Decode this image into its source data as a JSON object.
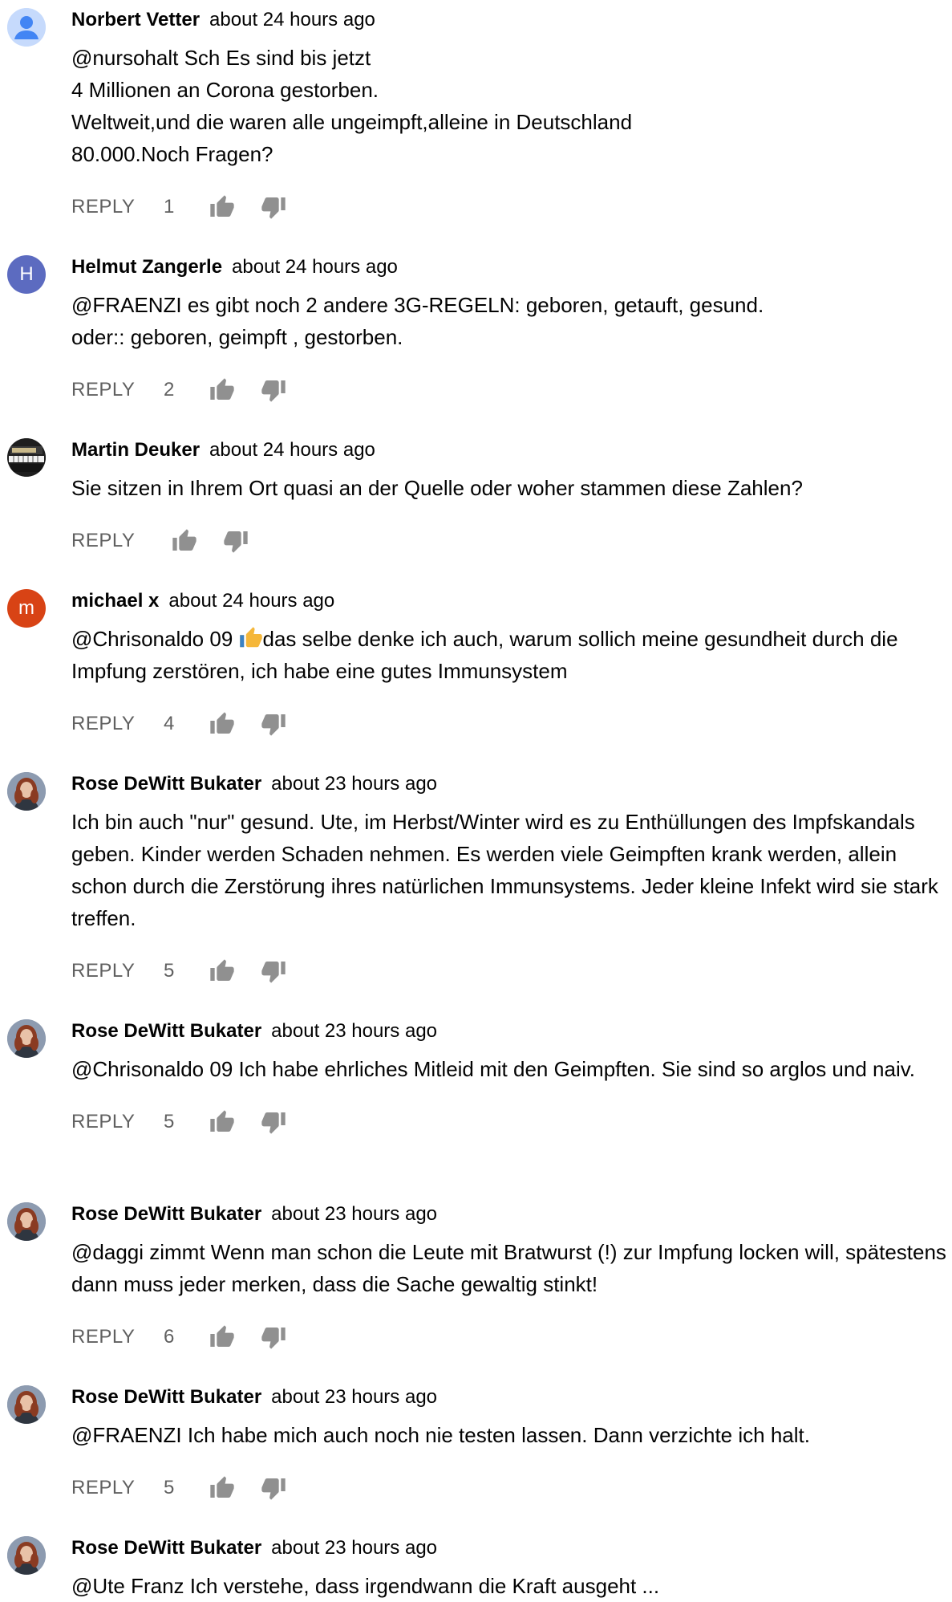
{
  "reply_label": "REPLY",
  "colors": {
    "author_text": "#030303",
    "secondary_text": "#606060",
    "icon": "#909090",
    "avatar_default_bg": "#c6dafc",
    "avatar_default_fg": "#4285f4",
    "avatar_h_bg": "#5c6bc0",
    "avatar_m_bg": "#d84315"
  },
  "comments": [
    {
      "author": "Norbert Vetter",
      "time": "about 24 hours ago",
      "avatar": {
        "type": "default-profile-icon"
      },
      "text": "@nursohalt Sch Es sind bis jetzt\n4 Millionen an Corona gestorben.\nWeltweit,und die waren alle ungeimpft,alleine in Deutschland\n80.000.Noch Fragen?",
      "likes": "1"
    },
    {
      "author": "Helmut Zangerle",
      "time": "about 24 hours ago",
      "avatar": {
        "type": "letter",
        "letter": "H",
        "color": "#5c6bc0"
      },
      "text": "@FRAENZI es gibt noch 2 andere 3G-REGELN: geboren, getauft, gesund.\noder:: geboren, geimpft , gestorben.",
      "likes": "2"
    },
    {
      "author": "Martin Deuker",
      "time": "about 24 hours ago",
      "avatar": {
        "type": "photo-piano"
      },
      "text": "Sie sitzen in Ihrem Ort quasi an der Quelle oder woher stammen diese Zahlen?",
      "likes": ""
    },
    {
      "author": "michael x",
      "time": "about 24 hours ago",
      "avatar": {
        "type": "letter",
        "letter": "m",
        "color": "#d84315"
      },
      "text_before_emoji": "@Chrisonaldo 09 ",
      "emoji": "thumbs-up-emoji",
      "text_after_emoji": "das selbe denke ich auch, warum sollich meine gesundheit durch die Impfung zerstören, ich habe eine gutes Immunsystem",
      "likes": "4"
    },
    {
      "author": "Rose DeWitt Bukater",
      "time": "about 23 hours ago",
      "avatar": {
        "type": "photo-portrait"
      },
      "text": "Ich bin auch \"nur\" gesund. Ute, im Herbst/Winter wird es zu Enthüllungen des Impfskandals geben. Kinder werden Schaden nehmen. Es werden viele Geimpften krank werden, allein schon durch die Zerstörung ihres natürlichen Immunsystems. Jeder kleine Infekt wird sie stark treffen.",
      "likes": "5"
    },
    {
      "author": "Rose DeWitt Bukater",
      "time": "about 23 hours ago",
      "avatar": {
        "type": "photo-portrait"
      },
      "text": "@Chrisonaldo 09 Ich habe ehrliches Mitleid mit den Geimpften. Sie sind so arglos und naiv.",
      "likes": "5"
    },
    {
      "author": "Rose DeWitt Bukater",
      "time": "about 23 hours ago",
      "avatar": {
        "type": "photo-portrait"
      },
      "text": "@daggi zimmt Wenn man schon die Leute mit Bratwurst (!) zur Impfung locken will, spätestens dann muss jeder merken, dass die Sache gewaltig stinkt!",
      "likes": "6"
    },
    {
      "author": "Rose DeWitt Bukater",
      "time": "about 23 hours ago",
      "avatar": {
        "type": "photo-portrait"
      },
      "text": "@FRAENZI Ich habe mich auch noch nie testen lassen. Dann verzichte ich halt.",
      "likes": "5"
    },
    {
      "author": "Rose DeWitt Bukater",
      "time": "about 23 hours ago",
      "avatar": {
        "type": "photo-portrait"
      },
      "text": "@Ute Franz Ich verstehe, dass irgendwann die Kraft ausgeht ...",
      "likes": ""
    }
  ]
}
